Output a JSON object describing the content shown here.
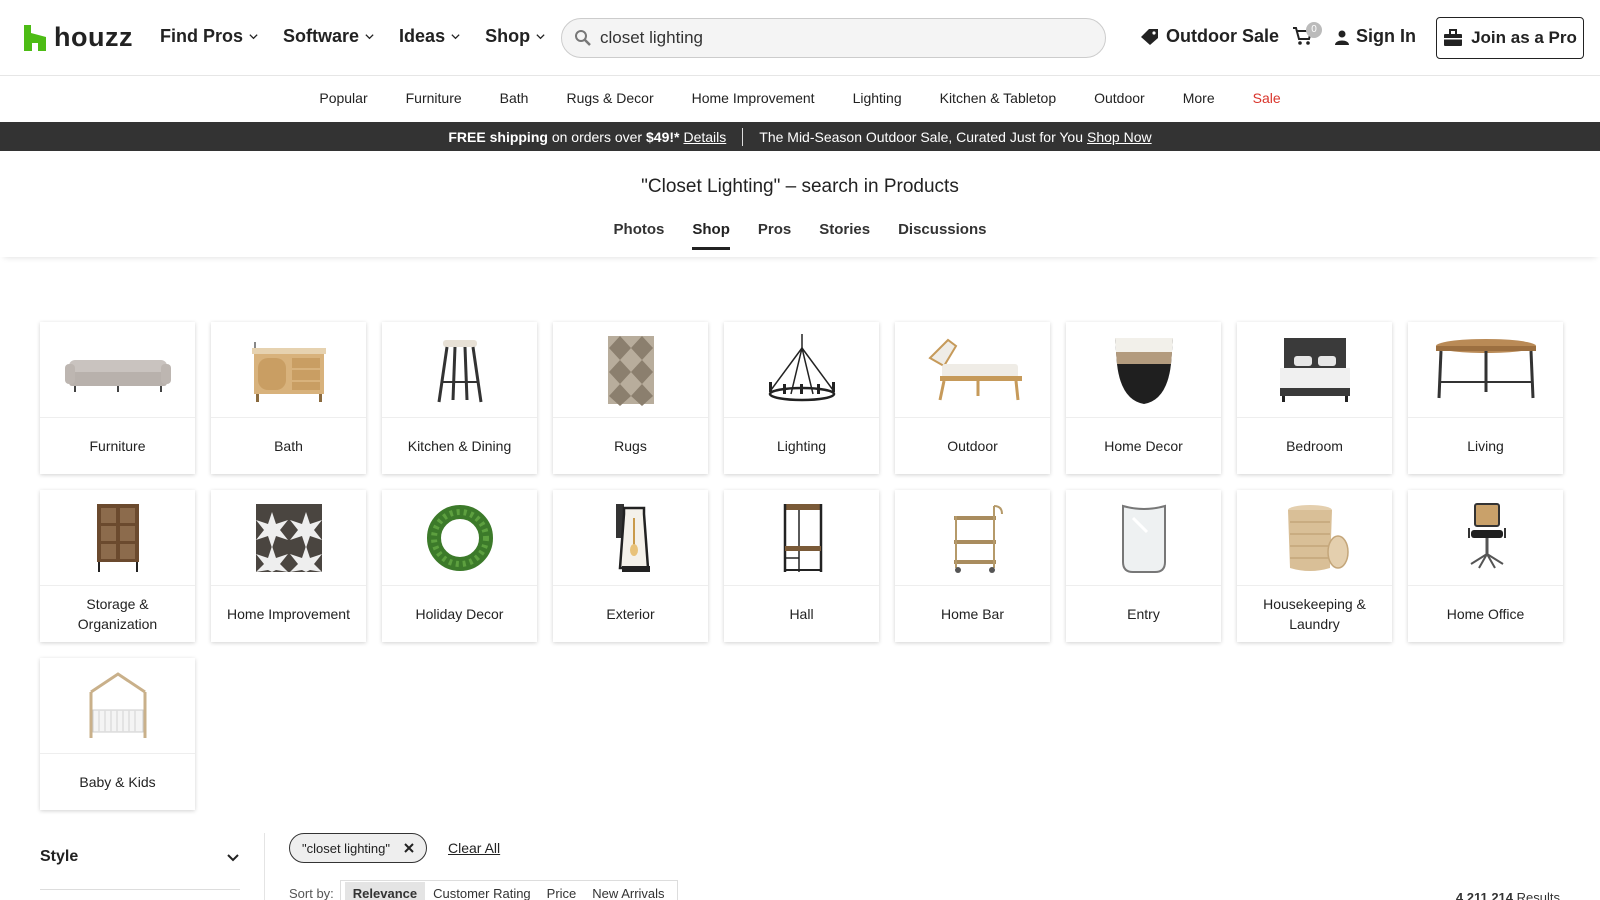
{
  "header": {
    "logo": "houzz",
    "nav": [
      {
        "label": "Find Pros"
      },
      {
        "label": "Software"
      },
      {
        "label": "Ideas"
      },
      {
        "label": "Shop"
      }
    ],
    "search_value": "closet lighting",
    "outdoor_sale": "Outdoor Sale",
    "cart_count": "0",
    "sign_in": "Sign In",
    "join": "Join as a Pro"
  },
  "categories": [
    "Popular",
    "Furniture",
    "Bath",
    "Rugs & Decor",
    "Home Improvement",
    "Lighting",
    "Kitchen & Tabletop",
    "Outdoor",
    "More",
    "Sale"
  ],
  "promo": {
    "free_shipping": "FREE shipping",
    "orders_over": "on orders over",
    "amount": "$49!*",
    "details": "Details",
    "sale_text": "The Mid-Season Outdoor Sale, Curated Just for You",
    "shop_now": "Shop Now"
  },
  "results": {
    "title": "\"Closet Lighting\" – search in Products",
    "tabs": [
      "Photos",
      "Shop",
      "Pros",
      "Stories",
      "Discussions"
    ],
    "active_tab": "Shop"
  },
  "tiles": [
    {
      "label": "Furniture",
      "icon": "sofa-icon"
    },
    {
      "label": "Bath",
      "icon": "vanity-icon"
    },
    {
      "label": "Kitchen & Dining",
      "icon": "stool-icon"
    },
    {
      "label": "Rugs",
      "icon": "rug-icon"
    },
    {
      "label": "Lighting",
      "icon": "chandelier-icon"
    },
    {
      "label": "Outdoor",
      "icon": "lounger-icon"
    },
    {
      "label": "Home Decor",
      "icon": "vase-icon"
    },
    {
      "label": "Bedroom",
      "icon": "bed-icon"
    },
    {
      "label": "Living",
      "icon": "coffee-table-icon"
    },
    {
      "label": "Storage & Organization",
      "icon": "cabinet-icon"
    },
    {
      "label": "Home Improvement",
      "icon": "tile-icon"
    },
    {
      "label": "Holiday Decor",
      "icon": "wreath-icon"
    },
    {
      "label": "Exterior",
      "icon": "lantern-icon"
    },
    {
      "label": "Hall",
      "icon": "hall-tree-icon"
    },
    {
      "label": "Home Bar",
      "icon": "bar-cart-icon"
    },
    {
      "label": "Entry",
      "icon": "mirror-icon"
    },
    {
      "label": "Housekeeping & Laundry",
      "icon": "hamper-icon"
    },
    {
      "label": "Home Office",
      "icon": "office-chair-icon"
    },
    {
      "label": "Baby & Kids",
      "icon": "crib-icon"
    }
  ],
  "filters": {
    "style_label": "Style",
    "chip": "\"closet lighting\"",
    "clear_all": "Clear All",
    "sort_by": "Sort by:",
    "sort_options": [
      "Relevance",
      "Customer Rating",
      "Price",
      "New Arrivals"
    ],
    "results_count": "4,211,214",
    "results_label": "Results"
  },
  "colors": {
    "brand": "#4dbc15",
    "sale": "#d9342b",
    "promo_bg": "#333333"
  }
}
